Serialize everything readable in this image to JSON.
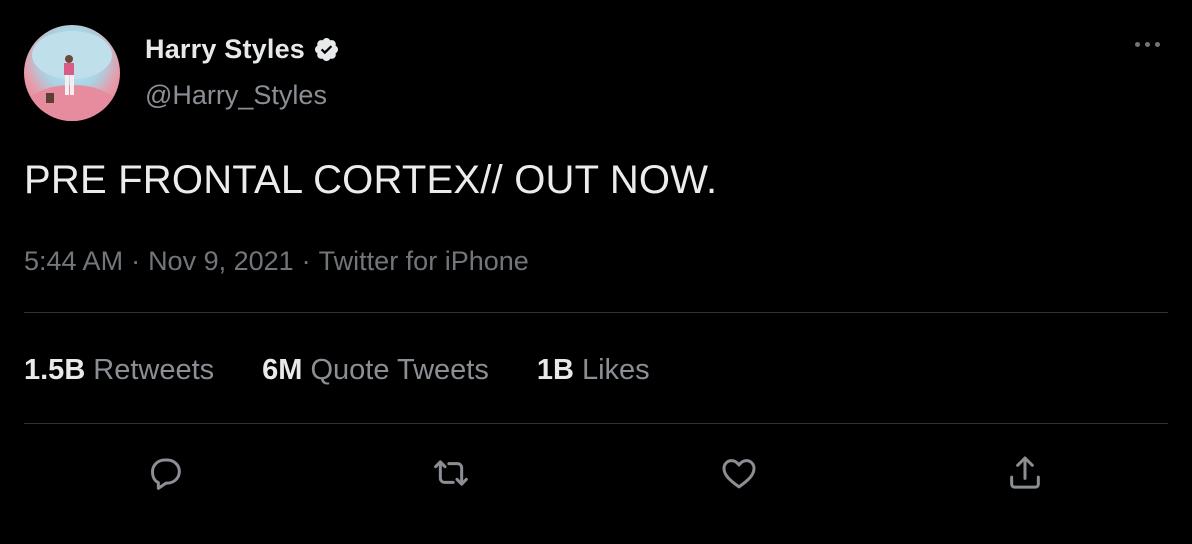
{
  "author": {
    "display_name": "Harry Styles",
    "handle": "@Harry_Styles",
    "verified": true
  },
  "tweet": {
    "text": "PRE FRONTAL CORTEX// OUT NOW."
  },
  "meta": {
    "time": "5:44 AM",
    "separator1": "·",
    "date": "Nov 9, 2021",
    "separator2": "·",
    "source": "Twitter for iPhone"
  },
  "stats": [
    {
      "value": "1.5B",
      "label": "Retweets"
    },
    {
      "value": "6M",
      "label": "Quote Tweets"
    },
    {
      "value": "1B",
      "label": "Likes"
    }
  ],
  "actions": [
    "reply-icon",
    "retweet-icon",
    "like-icon",
    "share-icon"
  ],
  "colors": {
    "background": "#000000",
    "primary_text": "#e7e9ea",
    "secondary_text": "#71767b",
    "divider": "#2f3336"
  }
}
